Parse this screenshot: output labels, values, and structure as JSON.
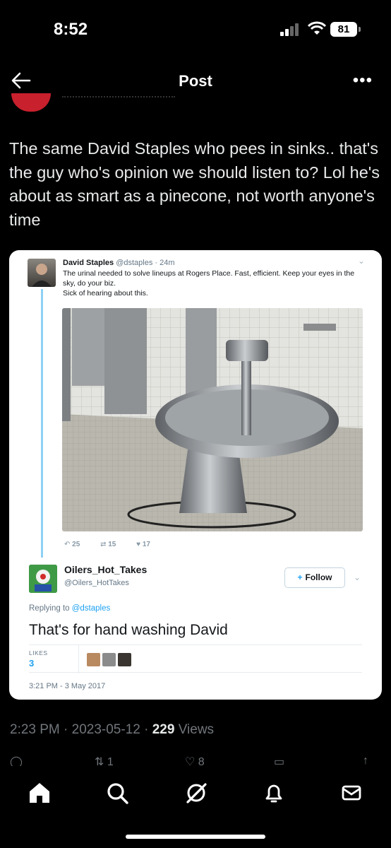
{
  "status_bar": {
    "time": "8:52",
    "battery": "81"
  },
  "header": {
    "title": "Post"
  },
  "post": {
    "text": "The same David Staples who pees in sinks.. that's the guy who's opinion we should listen to? Lol he's about as smart as a pinecone, not worth anyone's time",
    "timestamp": "2:23 PM · 2023-05-12 · ",
    "views_count": "229",
    "views_label": " Views"
  },
  "embedded": {
    "tweet1": {
      "name": "David Staples",
      "handle_time": " @dstaples · 24m",
      "body": "The urinal needed to solve lineups at Rogers Place. Fast, efficient. Keep your eyes in the sky, do your biz.",
      "body2": "Sick of hearing about this.",
      "replies": "25",
      "retweets": "15",
      "likes": "17"
    },
    "tweet2": {
      "name": "Oilers_Hot_Takes",
      "handle": "@Oilers_HotTakes",
      "follow_label": "Follow",
      "replying_prefix": "Replying to ",
      "replying_to": "@dstaples",
      "text": "That's for hand washing David",
      "likes_label": "LIKES",
      "likes_count": "3",
      "date": "3:21 PM - 3 May 2017"
    }
  },
  "actions_peek": {
    "retweets": "1",
    "likes": "8"
  },
  "colors": {
    "accent": "#1da1f2",
    "thread": "#8fd0f5",
    "muted": "#71767b"
  },
  "icons": [
    "back-arrow-icon",
    "more-icon",
    "home-icon",
    "search-icon",
    "grok-icon",
    "notifications-icon",
    "messages-icon"
  ]
}
